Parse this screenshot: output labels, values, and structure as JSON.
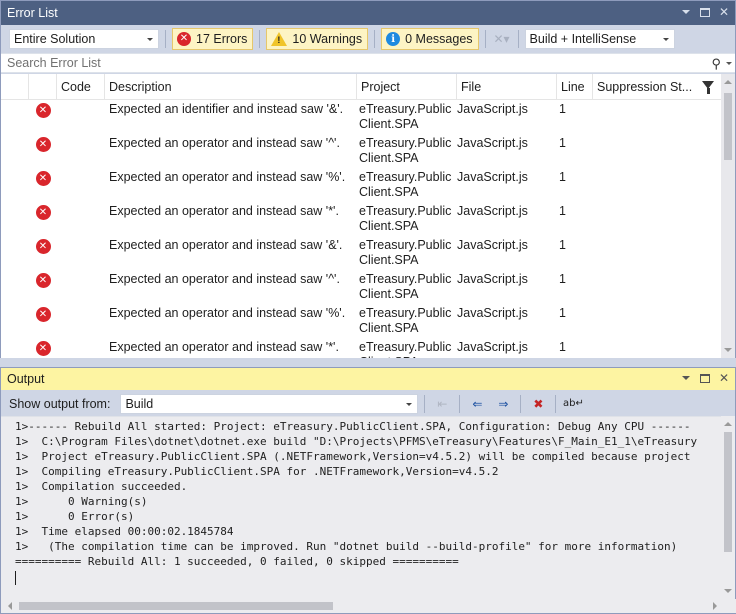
{
  "error_list": {
    "title": "Error List",
    "scope_dropdown": "Entire Solution",
    "errors_label": "17 Errors",
    "warnings_label": "10 Warnings",
    "messages_label": "0 Messages",
    "source_dropdown": "Build + IntelliSense",
    "search_placeholder": "Search Error List",
    "columns": {
      "code": "Code",
      "description": "Description",
      "project": "Project",
      "file": "File",
      "line": "Line",
      "suppression": "Suppression St..."
    },
    "rows": [
      {
        "severity": "error",
        "code": "",
        "description": "Expected an identifier and instead saw '&'.",
        "project": "eTreasury.PublicClient.SPA",
        "file": "JavaScript.js",
        "line": "1",
        "suppression": ""
      },
      {
        "severity": "error",
        "code": "",
        "description": "Expected an operator and instead saw '^'.",
        "project": "eTreasury.PublicClient.SPA",
        "file": "JavaScript.js",
        "line": "1",
        "suppression": ""
      },
      {
        "severity": "error",
        "code": "",
        "description": "Expected an operator and instead saw '%'.",
        "project": "eTreasury.PublicClient.SPA",
        "file": "JavaScript.js",
        "line": "1",
        "suppression": ""
      },
      {
        "severity": "error",
        "code": "",
        "description": "Expected an operator and instead saw '*'.",
        "project": "eTreasury.PublicClient.SPA",
        "file": "JavaScript.js",
        "line": "1",
        "suppression": ""
      },
      {
        "severity": "error",
        "code": "",
        "description": "Expected an operator and instead saw '&'.",
        "project": "eTreasury.PublicClient.SPA",
        "file": "JavaScript.js",
        "line": "1",
        "suppression": ""
      },
      {
        "severity": "error",
        "code": "",
        "description": "Expected an operator and instead saw '^'.",
        "project": "eTreasury.PublicClient.SPA",
        "file": "JavaScript.js",
        "line": "1",
        "suppression": ""
      },
      {
        "severity": "error",
        "code": "",
        "description": "Expected an operator and instead saw '%'.",
        "project": "eTreasury.PublicClient.SPA",
        "file": "JavaScript.js",
        "line": "1",
        "suppression": ""
      },
      {
        "severity": "error",
        "code": "",
        "description": "Expected an operator and instead saw '*'.",
        "project": "eTreasury.PublicClient.SPA",
        "file": "JavaScript.js",
        "line": "1",
        "suppression": ""
      }
    ]
  },
  "output": {
    "title": "Output",
    "show_from_label": "Show output from:",
    "show_from_value": "Build",
    "lines": [
      "1>------ Rebuild All started: Project: eTreasury.PublicClient.SPA, Configuration: Debug Any CPU ------",
      "1>  C:\\Program Files\\dotnet\\dotnet.exe build \"D:\\Projects\\PFMS\\eTreasury\\Features\\F_Main_E1_1\\eTreasury",
      "1>  Project eTreasury.PublicClient.SPA (.NETFramework,Version=v4.5.2) will be compiled because project",
      "1>  Compiling eTreasury.PublicClient.SPA for .NETFramework,Version=v4.5.2",
      "1>  Compilation succeeded.",
      "1>      0 Warning(s)",
      "1>      0 Error(s)",
      "1>  Time elapsed 00:00:02.1845784",
      "1>   (The compilation time can be improved. Run \"dotnet build --build-profile\" for more information)",
      "========== Rebuild All: 1 succeeded, 0 failed, 0 skipped =========="
    ]
  }
}
